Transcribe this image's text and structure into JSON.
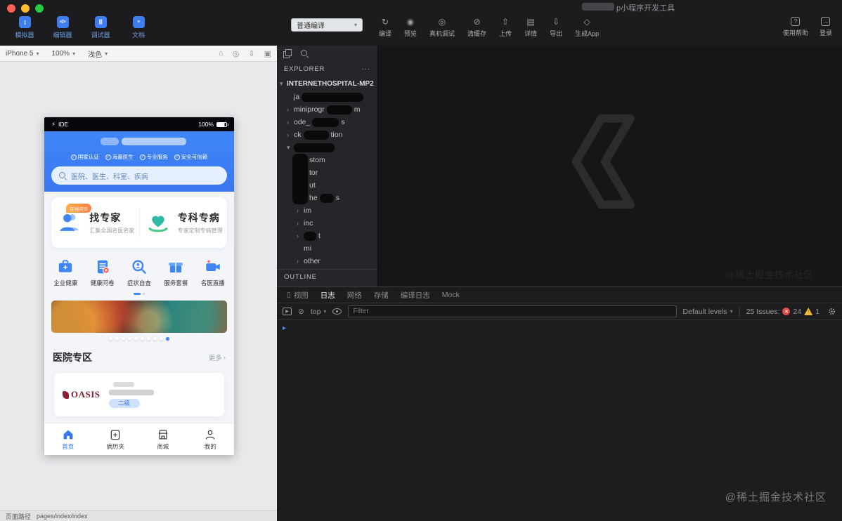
{
  "window": {
    "title": "p小程序开发工具",
    "watermark": "@稀土掘金技术社区"
  },
  "colors": {
    "accent_blue": "#3f86f2",
    "header_blue": "#3a77f0",
    "error_red": "#e04a4a",
    "warning_yellow": "#f2bd3a",
    "panel_dark": "#1d1d1f"
  },
  "topbar": {
    "panel_buttons": [
      {
        "label": "模拟器"
      },
      {
        "label": "编辑器"
      },
      {
        "label": "调试器"
      },
      {
        "label": "文档"
      }
    ],
    "compile_mode": "普通编译",
    "actions": [
      {
        "label": "编译"
      },
      {
        "label": "预览"
      },
      {
        "label": "真机调试"
      },
      {
        "label": "清缓存"
      },
      {
        "label": "上传"
      },
      {
        "label": "详情"
      },
      {
        "label": "导出"
      },
      {
        "label": "生成App"
      }
    ],
    "right_actions": [
      {
        "label": "使用帮助"
      },
      {
        "label": "登录"
      }
    ]
  },
  "simulator": {
    "device": "iPhone 5",
    "zoom": "100%",
    "theme": "浅色",
    "page_path_label": "页面路径",
    "page_path": "pages/index/index"
  },
  "phone": {
    "status": {
      "carrier": "IDE",
      "battery": "100%"
    },
    "badges": [
      "国家认证",
      "海量医生",
      "专业服务",
      "安全可信赖"
    ],
    "search_placeholder": "医院、医生、科室、疾病",
    "cards": [
      {
        "title": "找专家",
        "subtitle": "汇集全国名医名家",
        "tag": "在线问诊"
      },
      {
        "title": "专科专病",
        "subtitle": "专家定制专病管理"
      }
    ],
    "quick_links": [
      {
        "label": "企业健康"
      },
      {
        "label": "健康问卷"
      },
      {
        "label": "症状自查"
      },
      {
        "label": "服务套餐"
      },
      {
        "label": "名医直播"
      }
    ],
    "section": {
      "title": "医院专区",
      "more": "更多"
    },
    "hospital": {
      "logo": "OASIS",
      "level": "二级"
    },
    "tabbar": [
      {
        "label": "首页"
      },
      {
        "label": "病历夹"
      },
      {
        "label": "商城"
      },
      {
        "label": "我的"
      }
    ]
  },
  "explorer": {
    "header": "EXPLORER",
    "menu": "···",
    "project": "INTERNETHOSPITAL-MP2",
    "files": [
      {
        "name": "ja"
      },
      {
        "name": "miniprogr",
        "suffix": "m"
      },
      {
        "name": "ode_",
        "suffix": "s"
      },
      {
        "name": "ck",
        "suffix": "tion"
      },
      {
        "name": ""
      },
      {
        "name": "stom"
      },
      {
        "name": "tor"
      },
      {
        "name": "ut"
      },
      {
        "name": "he",
        "suffix": "s"
      },
      {
        "name": "im"
      },
      {
        "name": "inc"
      },
      {
        "name": "t"
      },
      {
        "name": "mi"
      },
      {
        "name": "other"
      }
    ],
    "outline": "OUTLINE"
  },
  "console": {
    "tabs": [
      {
        "label": "视图"
      },
      {
        "label": "日志"
      },
      {
        "label": "网络"
      },
      {
        "label": "存储"
      },
      {
        "label": "编译日志"
      },
      {
        "label": "Mock"
      }
    ],
    "context_select": "top",
    "filter_placeholder": "Filter",
    "levels_select": "Default levels",
    "issues_label": "25 Issues:",
    "error_count": "24",
    "warning_count": "1"
  }
}
